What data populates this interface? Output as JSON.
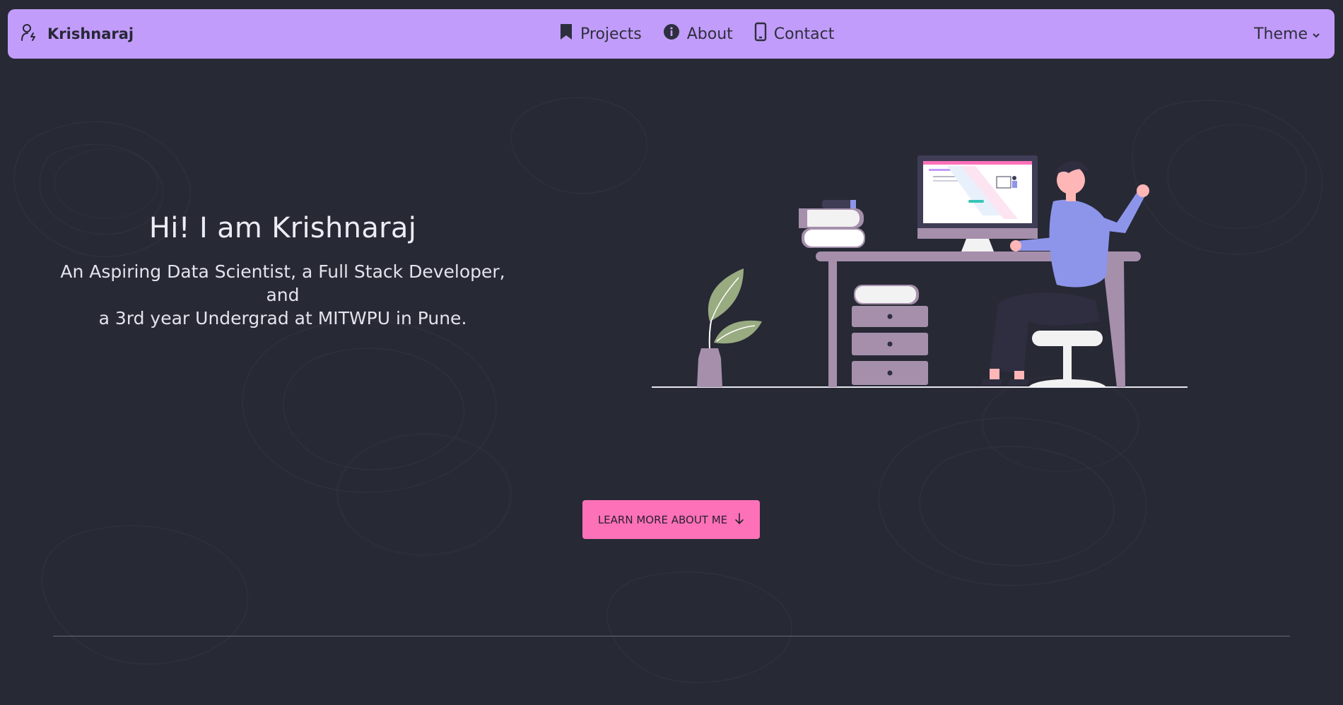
{
  "navbar": {
    "brand_name": "Krishnaraj",
    "brand_icon": "user-bolt-icon",
    "links": [
      {
        "label": "Projects",
        "icon": "bookmark-icon"
      },
      {
        "label": "About",
        "icon": "info-circle-icon"
      },
      {
        "label": "Contact",
        "icon": "phone-icon"
      }
    ],
    "theme_label": "Theme",
    "theme_icon": "chevron-down-icon"
  },
  "hero": {
    "title": "Hi! I am Krishnaraj",
    "subtitle_line1": "An Aspiring Data Scientist, a Full Stack Developer, and",
    "subtitle_line2": "a 3rd year Undergrad at MITWPU in Pune."
  },
  "cta": {
    "label": "LEARN MORE ABOUT ME",
    "icon": "arrow-down-icon"
  },
  "colors": {
    "background": "#272935",
    "navbar": "#c29cfa",
    "accent_pink": "#fd71b9",
    "illustration_purple": "#8d95ea",
    "furniture": "#a58fab"
  }
}
